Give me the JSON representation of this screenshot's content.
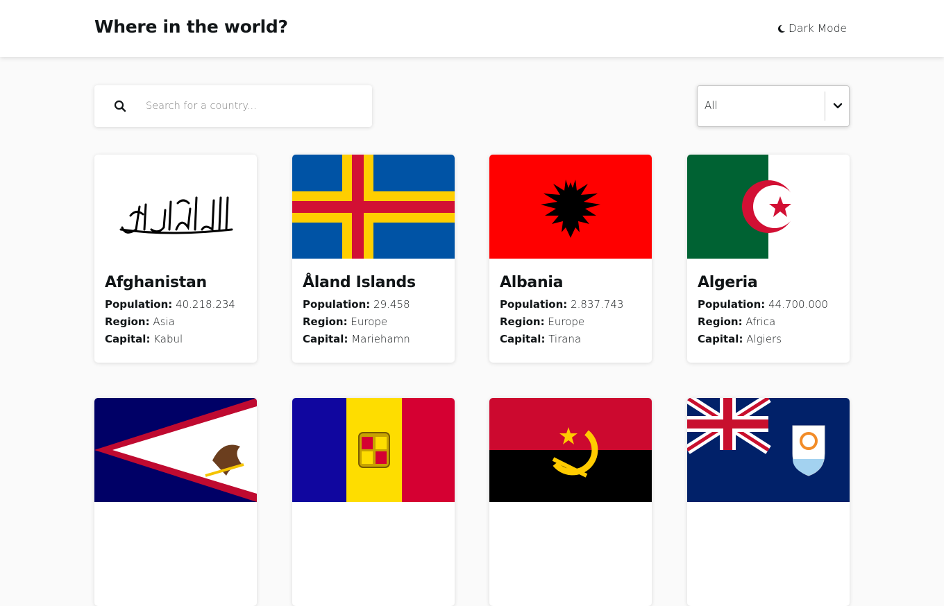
{
  "header": {
    "title": "Where in the world?",
    "dark_mode_label": "Dark Mode",
    "icon": "moon-icon"
  },
  "search": {
    "placeholder": "Search for a country...",
    "value": "",
    "icon": "search-icon"
  },
  "filter": {
    "selected": "All",
    "icon": "chevron-down-icon"
  },
  "labels": {
    "population": "Population:",
    "region": "Region:",
    "capital": "Capital:"
  },
  "countries": [
    {
      "name": "Afghanistan",
      "population": "40.218.234",
      "region": "Asia",
      "capital": "Kabul",
      "flag": "afghanistan-flag"
    },
    {
      "name": "Åland Islands",
      "population": "29.458",
      "region": "Europe",
      "capital": "Mariehamn",
      "flag": "aland-flag"
    },
    {
      "name": "Albania",
      "population": "2.837.743",
      "region": "Europe",
      "capital": "Tirana",
      "flag": "albania-flag"
    },
    {
      "name": "Algeria",
      "population": "44.700.000",
      "region": "Africa",
      "capital": "Algiers",
      "flag": "algeria-flag"
    },
    {
      "flag": "american-samoa-flag"
    },
    {
      "flag": "andorra-flag"
    },
    {
      "flag": "angola-flag"
    },
    {
      "flag": "anguilla-flag"
    }
  ],
  "colors": {
    "background": "#fafafa",
    "card": "#ffffff",
    "text": "#111517",
    "placeholder": "#858585"
  }
}
